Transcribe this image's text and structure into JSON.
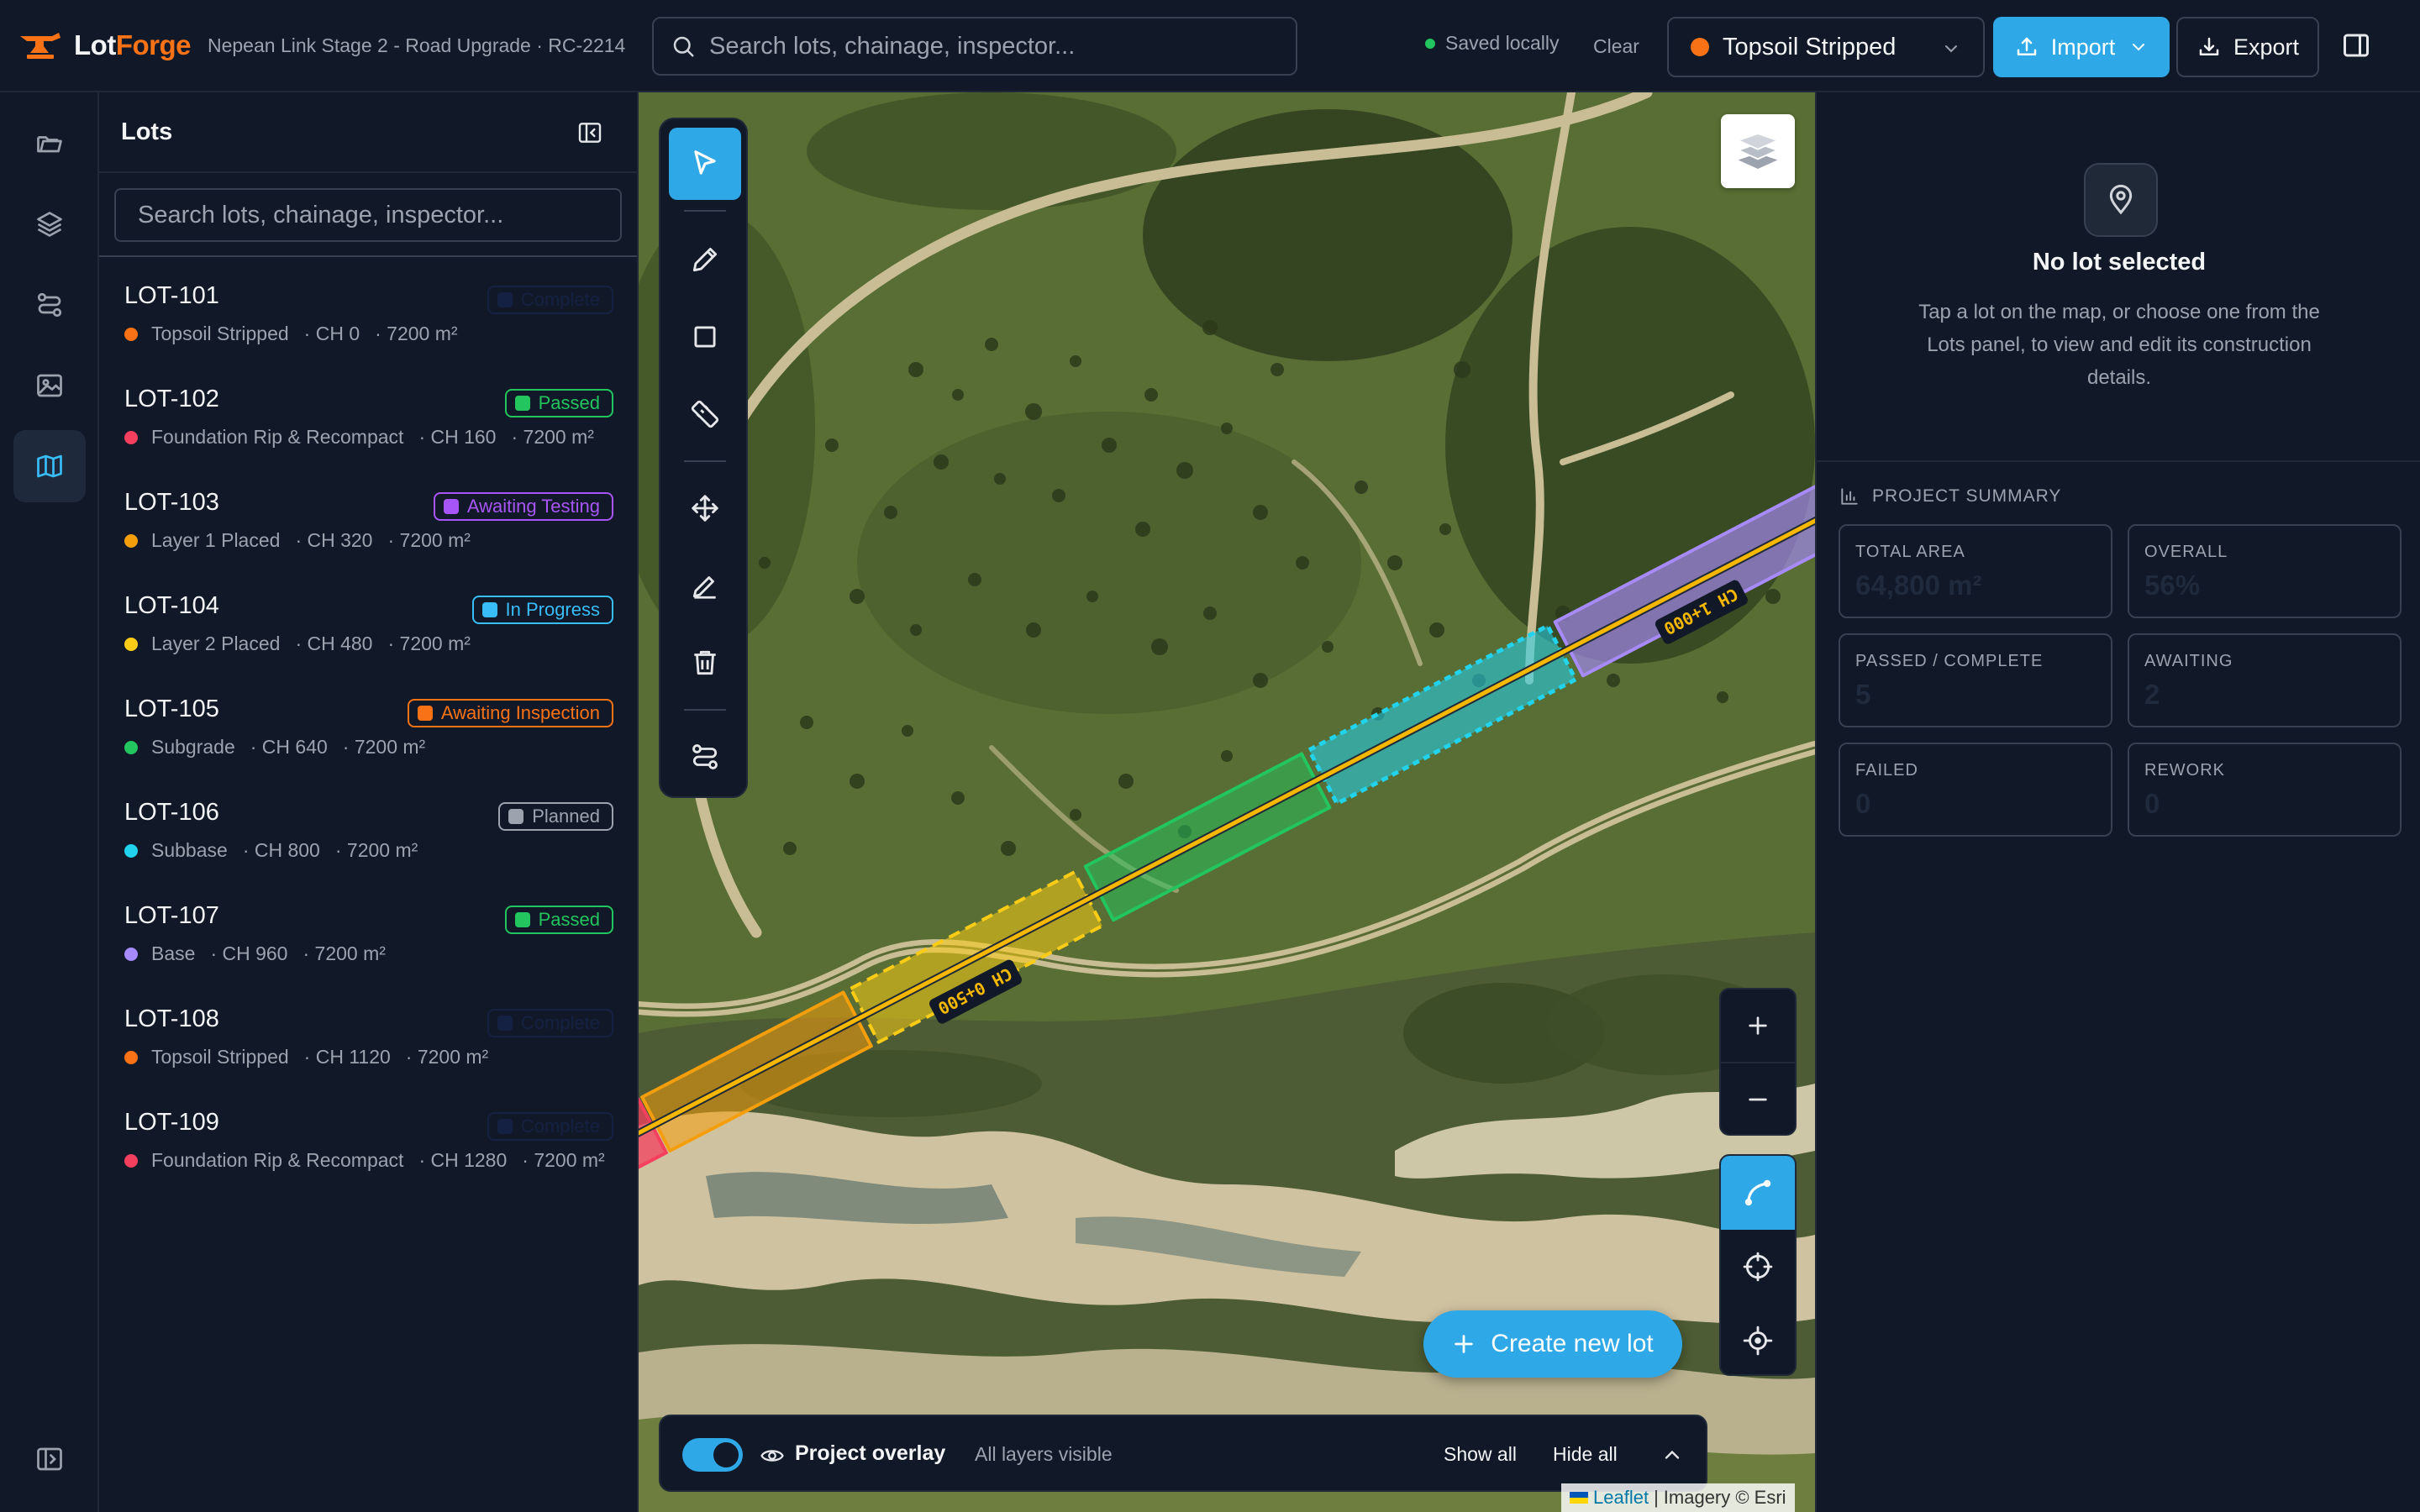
{
  "app": {
    "brand_first": "Lot",
    "brand_second": "Forge",
    "project": "Nepean Link Stage 2 - Road Upgrade · RC-2214"
  },
  "topbar": {
    "search_placeholder": "Search lots, chainage, inspector...",
    "saved_status": "Saved locally",
    "clear_label": "Clear",
    "stage_selected": "Topsoil Stripped",
    "import_label": "Import",
    "export_label": "Export"
  },
  "lots_panel": {
    "title": "Lots",
    "search_placeholder": "Search lots, chainage, inspector...",
    "items": [
      {
        "id": "LOT-101",
        "layer": "Topsoil Stripped",
        "chainage": "· CH 0",
        "area": "· 7200 m²",
        "status": "Complete",
        "status_visible": false
      },
      {
        "id": "LOT-102",
        "layer": "Foundation Rip & Recompact",
        "chainage": "· CH 160",
        "area": "· 7200 m²",
        "status": "Passed",
        "status_visible": true
      },
      {
        "id": "LOT-103",
        "layer": "Layer 1 Placed",
        "chainage": "· CH 320",
        "area": "· 7200 m²",
        "status": "Awaiting Testing",
        "status_visible": true
      },
      {
        "id": "LOT-104",
        "layer": "Layer 2 Placed",
        "chainage": "· CH 480",
        "area": "· 7200 m²",
        "status": "In Progress",
        "status_visible": true
      },
      {
        "id": "LOT-105",
        "layer": "Subgrade",
        "chainage": "· CH 640",
        "area": "· 7200 m²",
        "status": "Awaiting Inspection",
        "status_visible": true
      },
      {
        "id": "LOT-106",
        "layer": "Subbase",
        "chainage": "· CH 800",
        "area": "· 7200 m²",
        "status": "Planned",
        "status_visible": true
      },
      {
        "id": "LOT-107",
        "layer": "Base",
        "chainage": "· CH 960",
        "area": "· 7200 m²",
        "status": "Passed",
        "status_visible": true
      },
      {
        "id": "LOT-108",
        "layer": "Topsoil Stripped",
        "chainage": "· CH 1120",
        "area": "· 7200 m²",
        "status": "Complete",
        "status_visible": false
      },
      {
        "id": "LOT-109",
        "layer": "Foundation Rip & Recompact",
        "chainage": "· CH 1280",
        "area": "· 7200 m²",
        "status": "Complete",
        "status_visible": false
      }
    ]
  },
  "colors": {
    "topsoil": "#f97316",
    "foundation": "#f43f5e",
    "layer1": "#f59e0b",
    "layer2": "#facc15",
    "subgrade": "#22c55e",
    "subbase": "#22d3ee",
    "base": "#a78bfa",
    "passed": "#22c55e",
    "awaiting_testing": "#a855f7",
    "in_progress": "#38bdf8",
    "awaiting_inspection": "#f97316",
    "planned": "#9ca3af",
    "complete": "#1e3a8a",
    "accent": "#2ea8e6"
  },
  "map": {
    "chainage_labels": [
      "CH 1+000",
      "CH 0+500"
    ],
    "create_label": "Create new lot",
    "overlay_label": "Project overlay",
    "overlay_status": "All layers visible",
    "show_all": "Show all",
    "hide_all": "Hide all",
    "overlay_enabled": true,
    "attribution_leaflet": "Leaflet",
    "attribution_sep": "|",
    "attribution_imagery": "Imagery © Esri"
  },
  "details": {
    "empty_title": "No lot selected",
    "empty_desc": "Tap a lot on the map, or choose one from the Lots panel, to view and edit its construction details."
  },
  "summary": {
    "heading": "PROJECT SUMMARY",
    "total_area_label": "TOTAL AREA",
    "total_area": "64,800 m²",
    "overall_label": "OVERALL",
    "overall": "56%",
    "passed_label": "PASSED / COMPLETE",
    "passed": "5",
    "awaiting_label": "AWAITING",
    "awaiting": "2",
    "failed_label": "FAILED",
    "failed": "0",
    "rework_label": "REWORK",
    "rework": "0"
  }
}
